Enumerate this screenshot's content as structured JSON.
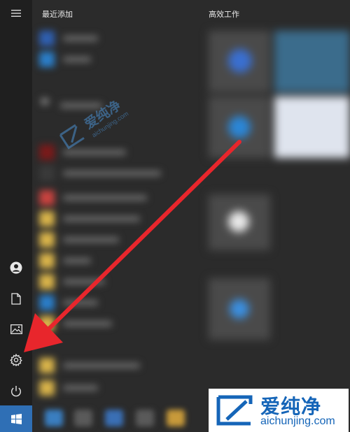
{
  "start_menu": {
    "recent_header": "最近添加",
    "productivity_header": "高效工作",
    "rail_icons": [
      "menu-icon",
      "user-icon",
      "document-icon",
      "pictures-icon",
      "settings-icon",
      "power-icon",
      "windows-start-icon"
    ]
  },
  "watermark": {
    "center_cn": "爱纯净",
    "center_en": "aichunjing.com",
    "logo_cn": "爱纯净",
    "logo_en": "aichunjing.com"
  },
  "colors": {
    "accent": "#2f6fb5",
    "arrow": "#e8262c",
    "logo_blue": "#1565b8"
  }
}
